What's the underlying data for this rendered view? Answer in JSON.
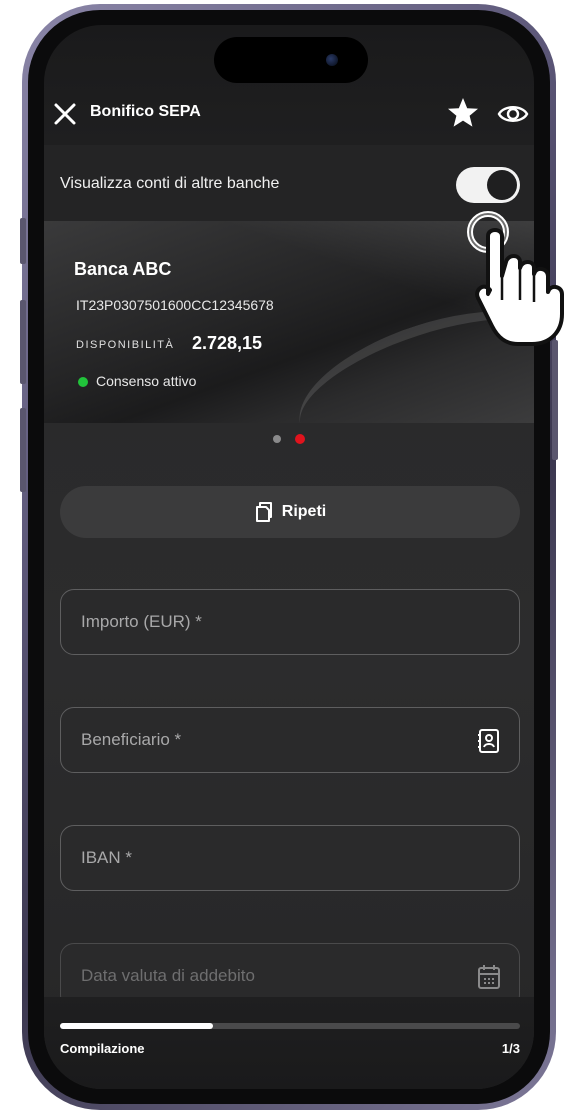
{
  "header": {
    "title": "Bonifico SEPA"
  },
  "toggle_row": {
    "label": "Visualizza conti di altre banche",
    "enabled": true
  },
  "bank_card": {
    "name": "Banca ABC",
    "iban": "IT23P0307501600CC12345678",
    "availability_label": "DISPONIBILITÀ",
    "availability_value": "2.728,15",
    "consent_text": "Consenso attivo",
    "consent_color": "#21c33b"
  },
  "pager": {
    "count": 2,
    "active_index": 1,
    "active_color": "#e0131d"
  },
  "repeat_button": {
    "label": "Ripeti"
  },
  "form": {
    "amount_placeholder": "Importo (EUR) *",
    "beneficiary_placeholder": "Beneficiario *",
    "iban_placeholder": "IBAN *",
    "value_date_placeholder": "Data valuta di addebito"
  },
  "progress": {
    "label": "Compilazione",
    "step": "1/3",
    "fraction": 0.333
  },
  "icons": {
    "close": "close-icon",
    "favorite": "star-icon",
    "visibility": "eye-icon",
    "copy": "copy-icon",
    "contacts": "address-book-icon",
    "calendar": "calendar-icon",
    "pointer": "hand-pointer-icon"
  }
}
